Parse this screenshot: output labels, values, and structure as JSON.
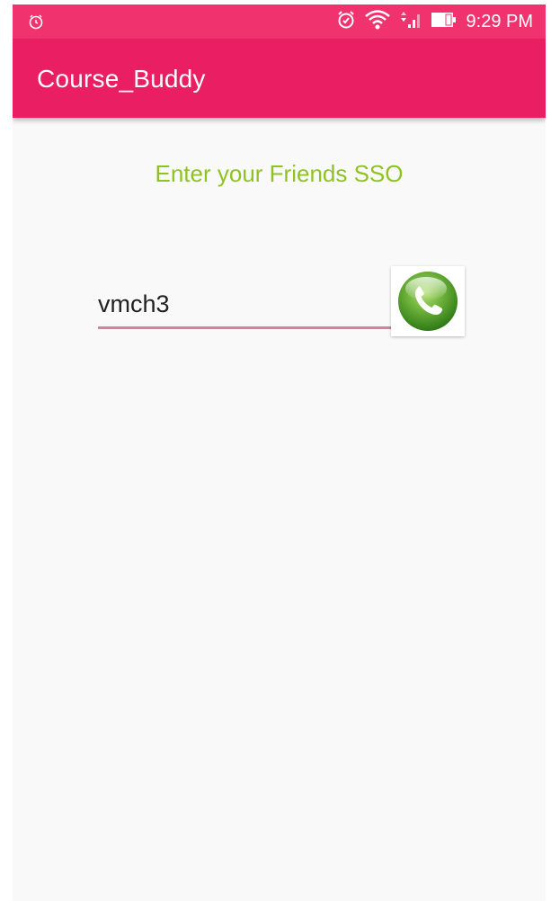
{
  "status_bar": {
    "time": "9:29 PM",
    "icons": [
      "alarm-icon",
      "alarm-clock-icon",
      "wifi-icon",
      "signal-icon",
      "battery-icon"
    ],
    "color": "#f0336e"
  },
  "app_bar": {
    "title": "Course_Buddy",
    "color": "#e91e63"
  },
  "main": {
    "prompt": "Enter your Friends SSO",
    "prompt_color": "#8fc31f",
    "sso_input": {
      "value": "vmch3",
      "underline_color": "#e07aa0"
    },
    "call_button": {
      "icon": "phone-call-icon",
      "color": "#5fa832"
    }
  }
}
